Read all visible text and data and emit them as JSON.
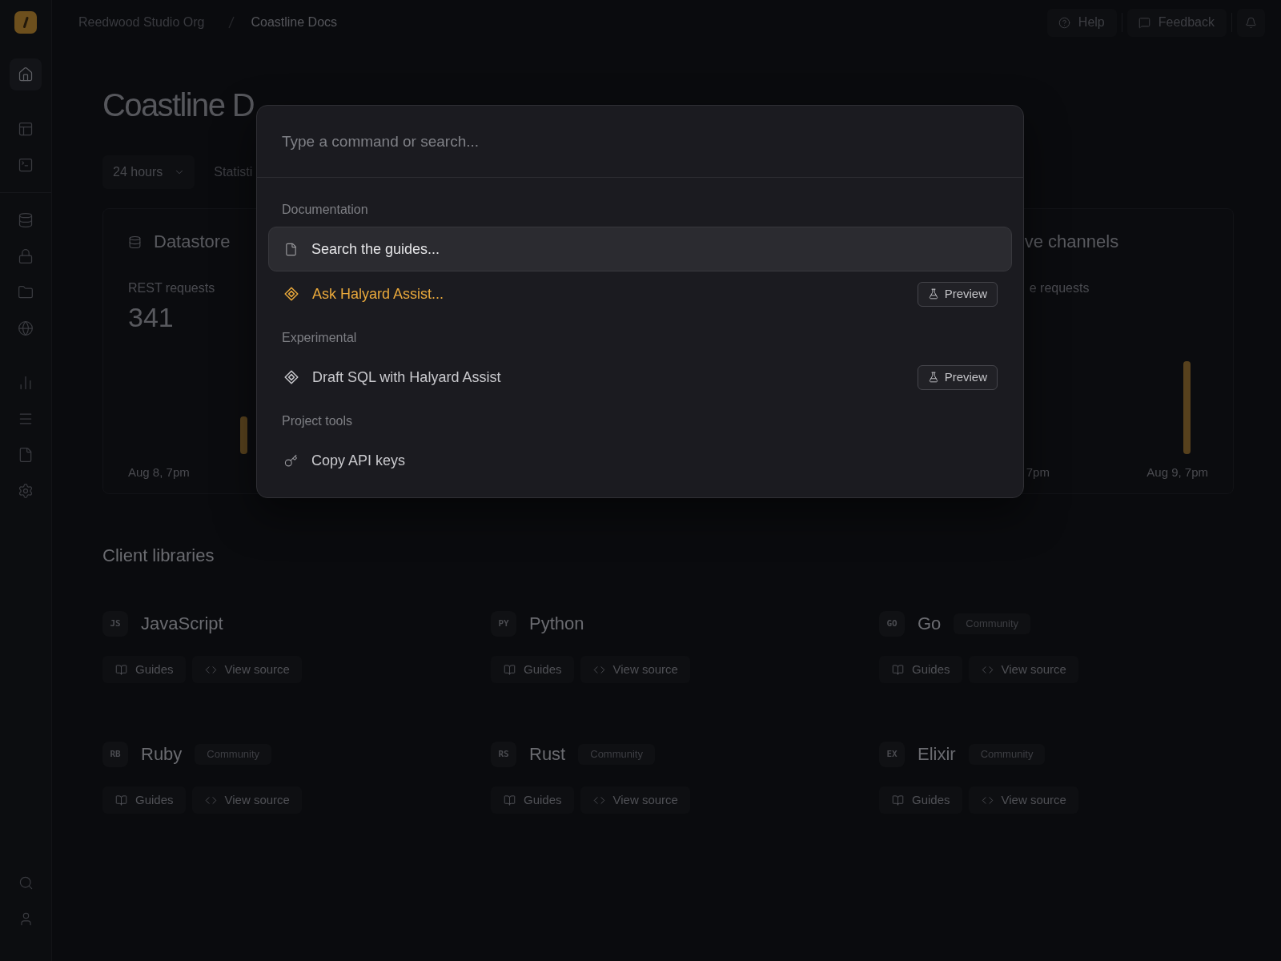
{
  "topbar": {
    "breadcrumbs": [
      {
        "label": "Reedwood Studio Org",
        "selected": false
      },
      {
        "label": "Coastline Docs",
        "selected": true
      }
    ],
    "actions": [
      {
        "kind": "help",
        "label": "Help"
      },
      {
        "kind": "feedback",
        "label": "Feedback"
      },
      {
        "kind": "notifications"
      }
    ]
  },
  "sidebar": {
    "groups": [
      {
        "items": [
          {
            "selected": true
          }
        ]
      },
      {
        "items": [
          {
            "selected": false
          },
          {
            "selected": false
          }
        ]
      },
      {
        "items": [
          {
            "selected": false
          },
          {
            "selected": false
          },
          {
            "selected": false
          },
          {
            "selected": false
          }
        ]
      },
      {
        "items": [
          {
            "selected": false
          },
          {
            "selected": false
          },
          {
            "selected": false
          },
          {
            "selected": false
          }
        ]
      }
    ]
  },
  "page": {
    "title": "Coastline D",
    "filters": [
      {
        "kind": "select",
        "label": "24 hours"
      },
      {
        "kind": "text",
        "label": "Statisti"
      }
    ],
    "datastore_card": {
      "title": "Datastore",
      "metric_label": "REST requests",
      "metric_value": "341",
      "axis_start": "Aug 8, 7pm"
    },
    "channels_card": {
      "title": "ve channels",
      "metric_label": "e requests",
      "axis_start": "7pm",
      "axis_end": "Aug 9, 7pm"
    }
  },
  "client_libraries": {
    "heading": "Client libraries",
    "items": [
      {
        "code": "JS",
        "name": "JavaScript",
        "links": [
          {
            "kind": "guides",
            "label": "Guides"
          },
          {
            "kind": "source",
            "label": "View source"
          }
        ]
      },
      {
        "code": "PY",
        "name": "Python",
        "links": [
          {
            "kind": "guides",
            "label": "Guides"
          },
          {
            "kind": "source",
            "label": "View source"
          }
        ]
      },
      {
        "code": "GO",
        "name": "Go",
        "tag": "Community",
        "links": [
          {
            "kind": "guides",
            "label": "Guides"
          },
          {
            "kind": "source",
            "label": "View source"
          }
        ]
      },
      {
        "code": "RB",
        "name": "Ruby",
        "tag": "Community",
        "links": [
          {
            "kind": "guides",
            "label": "Guides"
          },
          {
            "kind": "source",
            "label": "View source"
          }
        ]
      },
      {
        "code": "RS",
        "name": "Rust",
        "tag": "Community",
        "links": [
          {
            "kind": "guides",
            "label": "Guides"
          },
          {
            "kind": "source",
            "label": "View source"
          }
        ]
      },
      {
        "code": "EX",
        "name": "Elixir",
        "tag": "Community",
        "links": [
          {
            "kind": "guides",
            "label": "Guides"
          },
          {
            "kind": "source",
            "label": "View source"
          }
        ]
      }
    ]
  },
  "command_palette": {
    "search": {
      "placeholder": "Type a command or search..."
    },
    "groups": [
      {
        "heading": "Documentation",
        "items": [
          {
            "kind": "guide",
            "label": "Search the guides...",
            "selected": true,
            "color": "#e6e6e8"
          },
          {
            "kind": "assistant",
            "label": "Ask Halyard Assist...",
            "selected": false,
            "color": "#eaa93b",
            "badge": "Preview"
          }
        ]
      },
      {
        "heading": "Experimental",
        "items": [
          {
            "kind": "assistant",
            "label": "Draft SQL with Halyard Assist",
            "selected": false,
            "color": "#c9c9cd",
            "badge": "Preview"
          }
        ]
      },
      {
        "heading": "Project tools",
        "items": [
          {
            "kind": "key",
            "label": "Copy API keys",
            "selected": false,
            "color": "#c9c9cd"
          }
        ]
      }
    ]
  }
}
